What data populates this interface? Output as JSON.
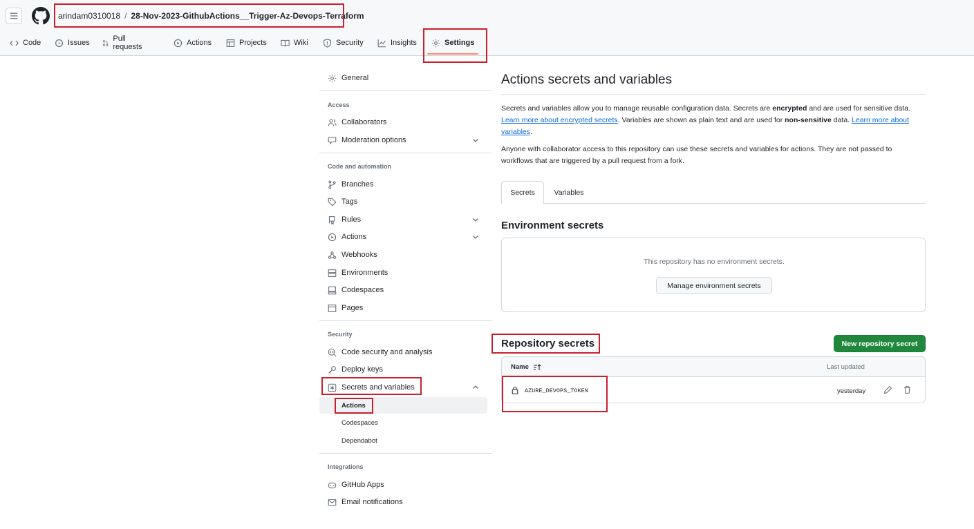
{
  "header": {
    "owner": "arindam0310018",
    "separator": "/",
    "repo": "28-Nov-2023-GithubActions__Trigger-Az-Devops-Terraform"
  },
  "repo_tabs": [
    {
      "label": "Code",
      "icon": "code-icon"
    },
    {
      "label": "Issues",
      "icon": "issue-icon"
    },
    {
      "label": "Pull requests",
      "icon": "pull-request-icon"
    },
    {
      "label": "Actions",
      "icon": "play-icon"
    },
    {
      "label": "Projects",
      "icon": "table-icon"
    },
    {
      "label": "Wiki",
      "icon": "book-icon"
    },
    {
      "label": "Security",
      "icon": "shield-icon"
    },
    {
      "label": "Insights",
      "icon": "graph-icon"
    },
    {
      "label": "Settings",
      "icon": "gear-icon",
      "selected": true
    }
  ],
  "sidebar": {
    "general": "General",
    "access_heading": "Access",
    "collaborators": "Collaborators",
    "moderation": "Moderation options",
    "code_heading": "Code and automation",
    "branches": "Branches",
    "tags": "Tags",
    "rules": "Rules",
    "actions": "Actions",
    "webhooks": "Webhooks",
    "environments": "Environments",
    "codespaces": "Codespaces",
    "pages": "Pages",
    "security_heading": "Security",
    "code_security": "Code security and analysis",
    "deploy_keys": "Deploy keys",
    "secrets_vars": "Secrets and variables",
    "sub_actions": "Actions",
    "sub_codespaces": "Codespaces",
    "sub_dependabot": "Dependabot",
    "integrations_heading": "Integrations",
    "github_apps": "GitHub Apps",
    "email_notifications": "Email notifications"
  },
  "main": {
    "title": "Actions secrets and variables",
    "desc1_a": "Secrets and variables allow you to manage reusable configuration data. Secrets are ",
    "desc1_b": "encrypted",
    "desc1_c": " and are used for sensitive data. ",
    "desc1_link1": "Learn more about encrypted secrets",
    "desc1_d": ". Variables are shown as plain text and are used for ",
    "desc1_e": "non-sensitive",
    "desc1_f": " data. ",
    "desc1_link2": "Learn more about variables",
    "desc1_g": ".",
    "desc2": "Anyone with collaborator access to this repository can use these secrets and variables for actions. They are not passed to workflows that are triggered by a pull request from a fork.",
    "tab_secrets": "Secrets",
    "tab_variables": "Variables",
    "env_heading": "Environment secrets",
    "env_empty": "This repository has no environment secrets.",
    "env_button": "Manage environment secrets",
    "repo_heading": "Repository secrets",
    "new_secret_button": "New repository secret",
    "col_name": "Name",
    "col_updated": "Last updated",
    "secrets": [
      {
        "name": "AZURE_DEVOPS_TOKEN",
        "updated": "yesterday"
      }
    ]
  },
  "colors": {
    "accent": "#0969da",
    "primary_button": "#1f883d",
    "selected_tab_underline": "#fd8c73",
    "annotation_box": "#c8202d"
  }
}
